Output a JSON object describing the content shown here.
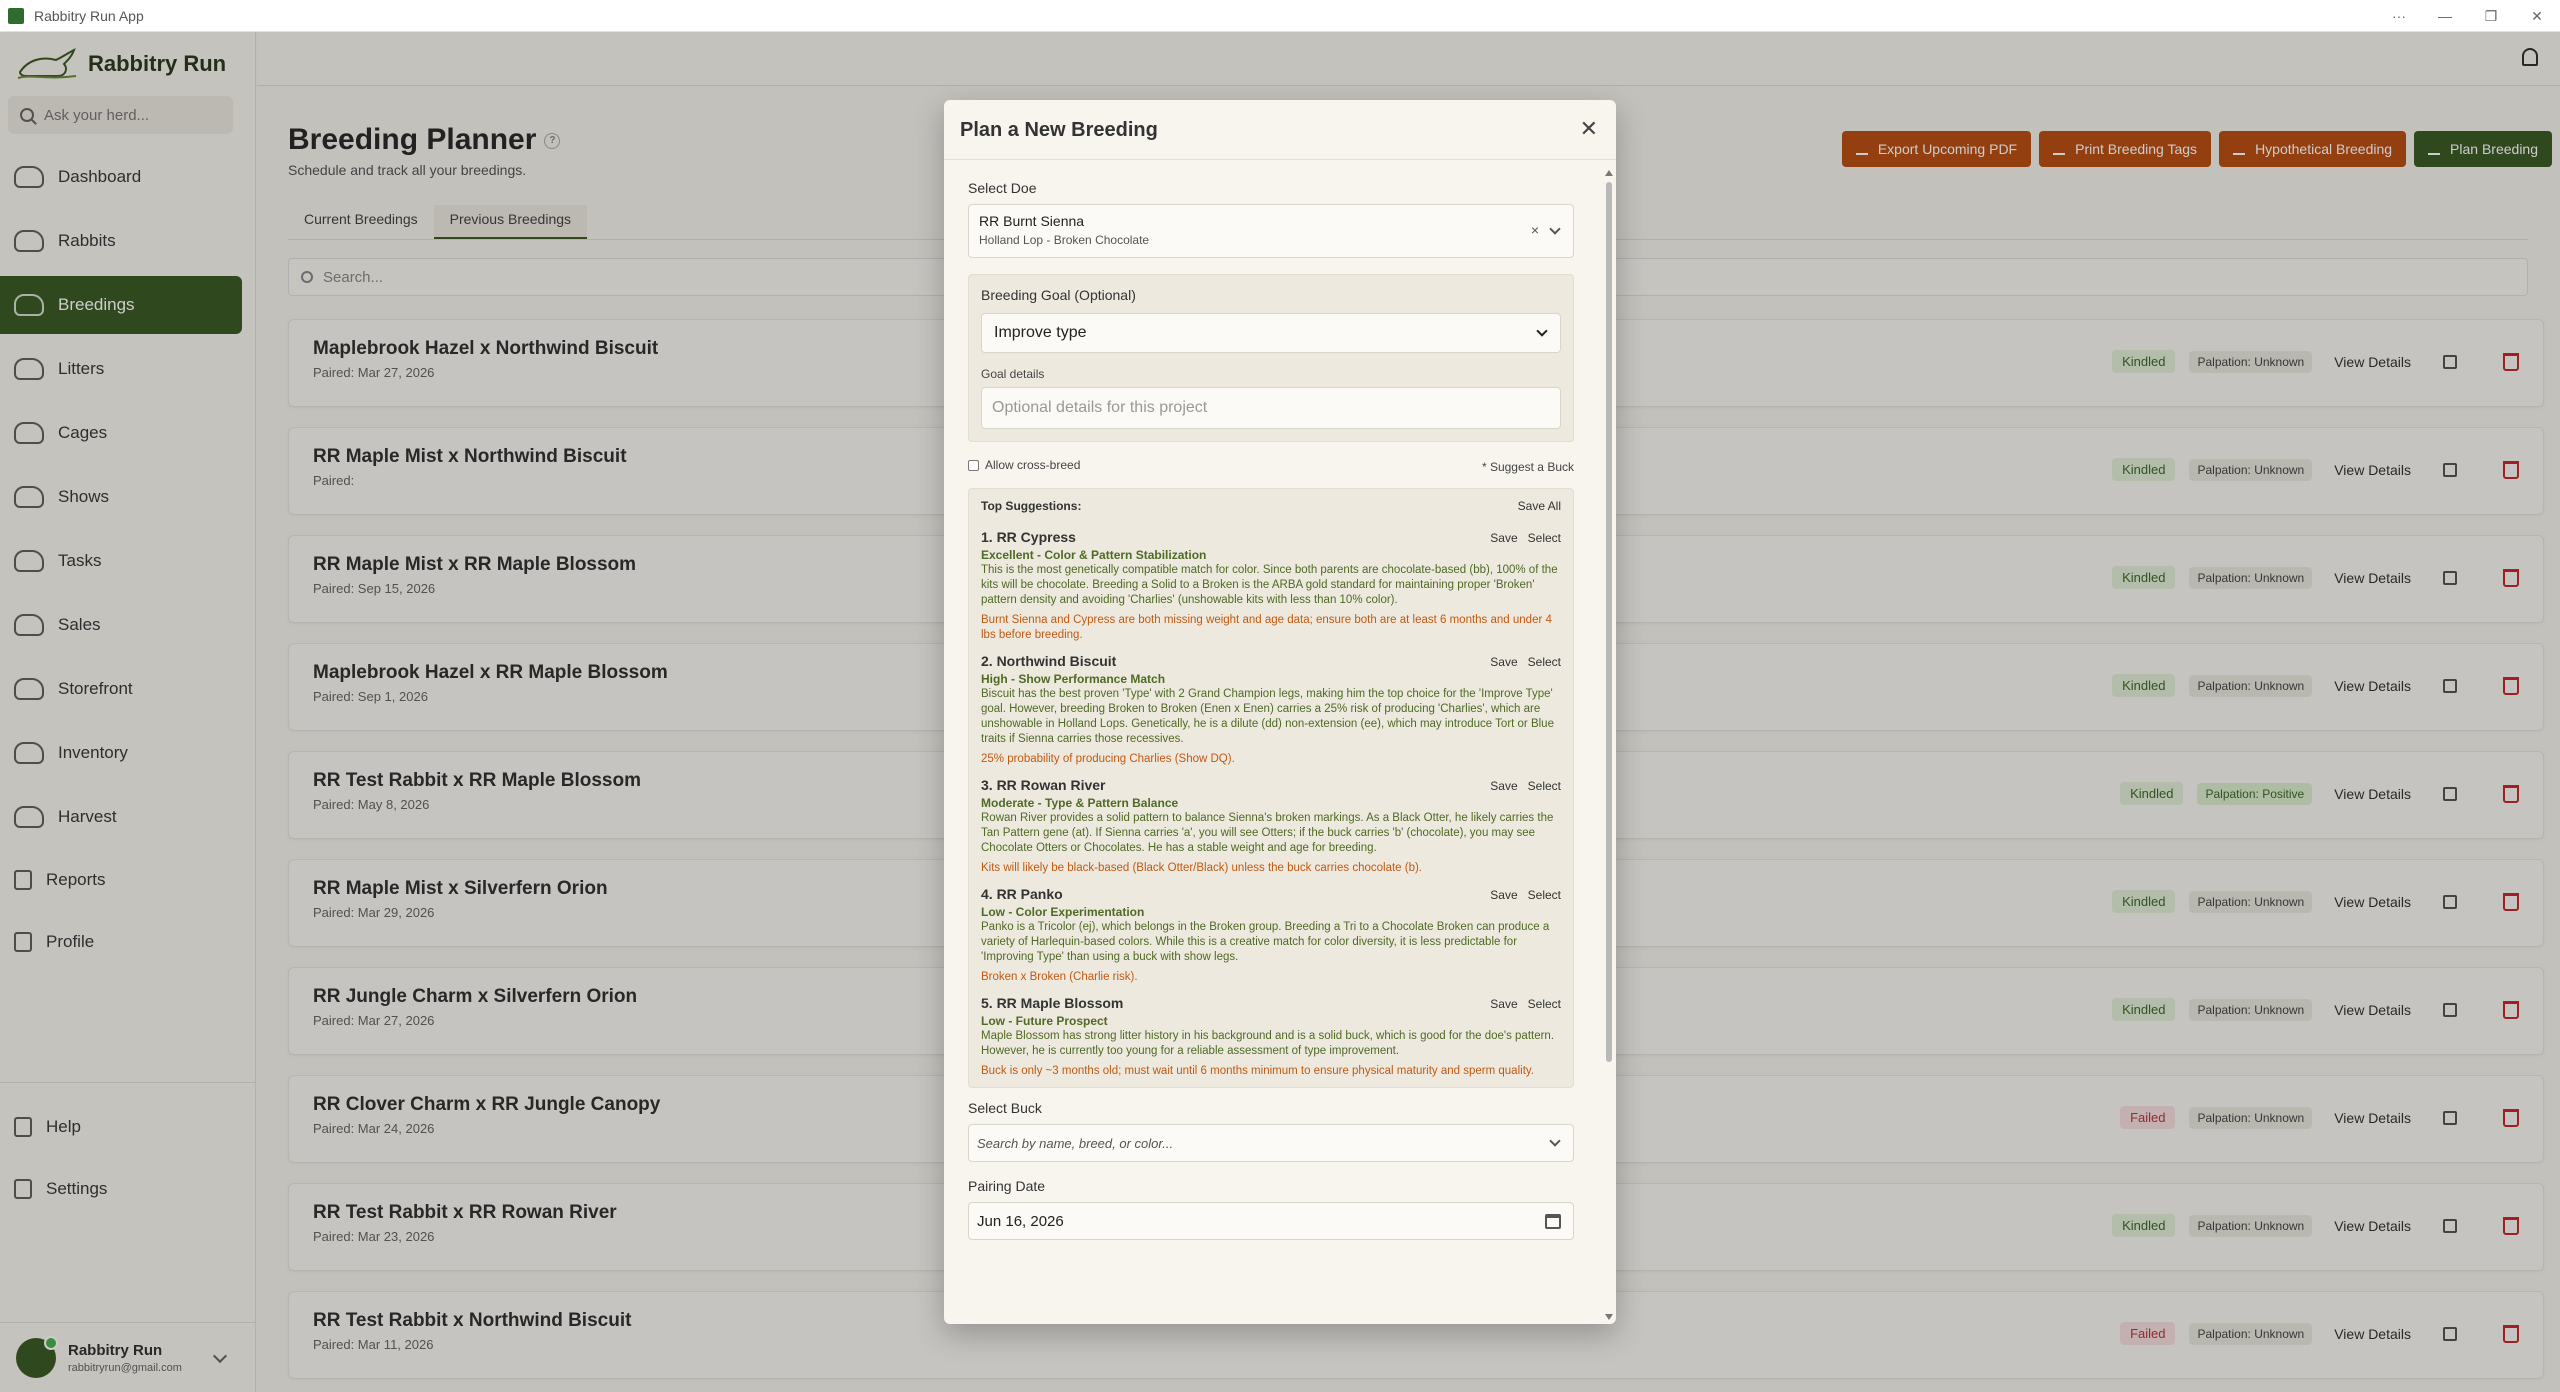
{
  "window": {
    "title": "Rabbitry Run App",
    "controls": [
      "···",
      "—",
      "❐",
      "✕"
    ]
  },
  "sidebar": {
    "brand": "Rabbitry Run",
    "search_placeholder": "Ask your herd...",
    "items": [
      {
        "label": "Dashboard",
        "icon": "dashboard-icon"
      },
      {
        "label": "Rabbits",
        "icon": "rabbit-icon"
      },
      {
        "label": "Breedings",
        "icon": "breedings-icon"
      },
      {
        "label": "Litters",
        "icon": "litters-icon"
      },
      {
        "label": "Cages",
        "icon": "cages-icon"
      },
      {
        "label": "Shows",
        "icon": "shows-icon"
      },
      {
        "label": "Tasks",
        "icon": "tasks-icon"
      },
      {
        "label": "Sales",
        "icon": "sales-icon"
      },
      {
        "label": "Storefront",
        "icon": "storefront-icon"
      },
      {
        "label": "Inventory",
        "icon": "inventory-icon"
      },
      {
        "label": "Harvest",
        "icon": "harvest-icon"
      },
      {
        "label": "Reports",
        "icon": "reports-icon"
      },
      {
        "label": "Profile",
        "icon": "profile-icon"
      }
    ],
    "bottom_items": [
      {
        "label": "Help",
        "icon": "help-icon"
      },
      {
        "label": "Settings",
        "icon": "settings-icon"
      }
    ],
    "user": {
      "name": "Rabbitry Run",
      "email": "rabbitryrun@gmail.com"
    }
  },
  "page": {
    "title": "Breeding Planner",
    "subtitle": "Schedule and track all your breedings.",
    "actions": [
      "Export Upcoming PDF",
      "Print Breeding Tags",
      "Hypothetical Breeding",
      "Plan Breeding"
    ],
    "tabs": [
      "Current Breedings",
      "Previous Breedings"
    ],
    "search_placeholder": "Search...",
    "view_label": "View Details",
    "breedings": [
      {
        "title": "Maplebrook Hazel x Northwind Biscuit",
        "date": "Paired: Mar 27, 2026",
        "status": "Kindled",
        "palpation": "Palpation: Unknown"
      },
      {
        "title": "RR Maple Mist x Northwind Biscuit",
        "date": "Paired:",
        "status": "Kindled",
        "palpation": "Palpation: Unknown"
      },
      {
        "title": "RR Maple Mist x RR Maple Blossom",
        "date": "Paired: Sep 15, 2026",
        "status": "Kindled",
        "palpation": "Palpation: Unknown"
      },
      {
        "title": "Maplebrook Hazel x RR Maple Blossom",
        "date": "Paired: Sep 1, 2026",
        "status": "Kindled",
        "palpation": "Palpation: Unknown"
      },
      {
        "title": "RR Test Rabbit x RR Maple Blossom",
        "date": "Paired: May 8, 2026",
        "status": "Kindled",
        "palpation": "Palpation: Positive"
      },
      {
        "title": "RR Maple Mist x Silverfern Orion",
        "date": "Paired: Mar 29, 2026",
        "status": "Kindled",
        "palpation": "Palpation: Unknown"
      },
      {
        "title": "RR Jungle Charm x Silverfern Orion",
        "date": "Paired: Mar 27, 2026",
        "status": "Kindled",
        "palpation": "Palpation: Unknown"
      },
      {
        "title": "RR Clover Charm x RR Jungle Canopy",
        "date": "Paired: Mar 24, 2026",
        "status": "Failed",
        "palpation": "Palpation: Unknown"
      },
      {
        "title": "RR Test Rabbit x RR Rowan River",
        "date": "Paired: Mar 23, 2026",
        "status": "Kindled",
        "palpation": "Palpation: Unknown"
      },
      {
        "title": "RR Test Rabbit x Northwind Biscuit",
        "date": "Paired: Mar 11, 2026",
        "status": "Failed",
        "palpation": "Palpation: Unknown"
      }
    ]
  },
  "modal": {
    "title": "Plan a New Breeding",
    "doe_label": "Select Doe",
    "doe_name": "RR Burnt Sienna",
    "doe_breed": "Holland Lop - Broken Chocolate",
    "goal_label": "Breeding Goal (Optional)",
    "goal_value": "Improve type",
    "goal_details_label": "Goal details",
    "goal_details_placeholder": "Optional details for this project",
    "cross_breed_label": "Allow cross-breed",
    "suggest_label": "* Suggest a Buck",
    "suggestions_heading": "Top Suggestions:",
    "save_all": "Save All",
    "save_label": "Save",
    "select_label": "Select",
    "suggestions": [
      {
        "title": "1. RR Cypress",
        "tier": "Excellent - Color & Pattern Stabilization",
        "desc": "This is the most genetically compatible match for color. Since both parents are chocolate-based (bb), 100% of the kits will be chocolate. Breeding a Solid to a Broken is the ARBA gold standard for maintaining proper 'Broken' pattern density and avoiding 'Charlies' (unshowable kits with less than 10% color).",
        "warn": "Burnt Sienna and Cypress are both missing weight and age data; ensure both are at least 6 months and under 4 lbs before breeding."
      },
      {
        "title": "2. Northwind Biscuit",
        "tier": "High - Show Performance Match",
        "desc": "Biscuit has the best proven 'Type' with 2 Grand Champion legs, making him the top choice for the 'Improve Type' goal. However, breeding Broken to Broken (Enen x Enen) carries a 25% risk of producing 'Charlies', which are unshowable in Holland Lops. Genetically, he is a dilute (dd) non-extension (ee), which may introduce Tort or Blue traits if Sienna carries those recessives.",
        "warn": "25% probability of producing Charlies (Show DQ)."
      },
      {
        "title": "3. RR Rowan River",
        "tier": "Moderate - Type & Pattern Balance",
        "desc": "Rowan River provides a solid pattern to balance Sienna's broken markings. As a Black Otter, he likely carries the Tan Pattern gene (at). If Sienna carries 'a', you will see Otters; if the buck carries 'b' (chocolate), you may see Chocolate Otters or Chocolates. He has a stable weight and age for breeding.",
        "warn": "Kits will likely be black-based (Black Otter/Black) unless the buck carries chocolate (b)."
      },
      {
        "title": "4. RR Panko",
        "tier": "Low - Color Experimentation",
        "desc": "Panko is a Tricolor (ej), which belongs in the Broken group. Breeding a Tri to a Chocolate Broken can produce a variety of Harlequin-based colors. While this is a creative match for color diversity, it is less predictable for 'Improving Type' than using a buck with show legs.",
        "warn": "Broken x Broken (Charlie risk)."
      },
      {
        "title": "5. RR Maple Blossom",
        "tier": "Low - Future Prospect",
        "desc": "Maple Blossom has strong litter history in his background and is a solid buck, which is good for the doe's pattern. However, he is currently too young for a reliable assessment of type improvement.",
        "warn": "Buck is only ~3 months old; must wait until 6 months minimum to ensure physical maturity and sperm quality."
      }
    ],
    "buck_label": "Select Buck",
    "buck_placeholder": "Search by name, breed, or color...",
    "date_label": "Pairing Date",
    "date_value": "Jun 16, 2026"
  },
  "colors": {
    "primary_green": "#3d5a26",
    "action_orange": "#b84f14",
    "danger_red": "#c62828",
    "suggestion_green": "#4f6a24",
    "warning_orange": "#c15a12"
  }
}
